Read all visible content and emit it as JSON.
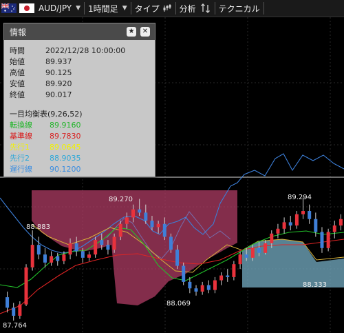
{
  "toolbar": {
    "pair": "AUD/JPY",
    "period": "1時間足",
    "type_label": "タイプ",
    "analysis_label": "分析",
    "technical_label": "テクニカル"
  },
  "info": {
    "title": "情報",
    "time_label": "時間",
    "time_value": "2022/12/28 10:00:00",
    "open_label": "始値",
    "open_value": "89.937",
    "high_label": "高値",
    "high_value": "90.125",
    "low_label": "安値",
    "low_value": "89.920",
    "close_label": "終値",
    "close_value": "90.017",
    "ichimoku_title": "一目均衡表(9,26,52)",
    "tenkan_label": "転換線",
    "tenkan_value": "89.9160",
    "kijun_label": "基準線",
    "kijun_value": "89.7830",
    "senkou1_label": "先行1",
    "senkou1_value": "89.0645",
    "senkou2_label": "先行2",
    "senkou2_value": "88.9035",
    "chikou_label": "遅行線",
    "chikou_value": "90.1200"
  },
  "colors": {
    "up": "#e8323c",
    "down": "#3f7fd8",
    "tenkan": "#22c22a",
    "kijun": "#e02424",
    "senkou1": "#d9b23a",
    "chikou": "#3c7fd8",
    "cloud_bear": "#a83a60",
    "cloud_bull": "#6ea3b8"
  },
  "chart_data": {
    "type": "candlestick",
    "price_labels": [
      "89.270",
      "88.883",
      "89.294",
      "88.069",
      "88.333",
      "87.764"
    ],
    "candles": [
      {
        "o": 88.05,
        "h": 88.12,
        "l": 87.86,
        "c": 87.92
      },
      {
        "o": 87.92,
        "h": 87.98,
        "l": 87.76,
        "c": 87.82
      },
      {
        "o": 87.82,
        "h": 88.0,
        "l": 87.78,
        "c": 87.96
      },
      {
        "o": 87.96,
        "h": 88.46,
        "l": 87.94,
        "c": 88.42
      },
      {
        "o": 88.42,
        "h": 88.88,
        "l": 88.38,
        "c": 88.7
      },
      {
        "o": 88.7,
        "h": 88.8,
        "l": 88.52,
        "c": 88.58
      },
      {
        "o": 88.58,
        "h": 88.66,
        "l": 88.42,
        "c": 88.48
      },
      {
        "o": 88.48,
        "h": 88.62,
        "l": 88.44,
        "c": 88.56
      },
      {
        "o": 88.56,
        "h": 88.6,
        "l": 88.44,
        "c": 88.5
      },
      {
        "o": 88.5,
        "h": 88.62,
        "l": 88.46,
        "c": 88.58
      },
      {
        "o": 88.58,
        "h": 88.78,
        "l": 88.52,
        "c": 88.72
      },
      {
        "o": 88.72,
        "h": 88.8,
        "l": 88.56,
        "c": 88.62
      },
      {
        "o": 88.62,
        "h": 88.66,
        "l": 88.48,
        "c": 88.54
      },
      {
        "o": 88.54,
        "h": 88.62,
        "l": 88.5,
        "c": 88.58
      },
      {
        "o": 88.58,
        "h": 88.8,
        "l": 88.54,
        "c": 88.76
      },
      {
        "o": 88.76,
        "h": 88.84,
        "l": 88.64,
        "c": 88.7
      },
      {
        "o": 88.7,
        "h": 88.76,
        "l": 88.58,
        "c": 88.64
      },
      {
        "o": 88.64,
        "h": 88.84,
        "l": 88.6,
        "c": 88.8
      },
      {
        "o": 88.8,
        "h": 89.0,
        "l": 88.76,
        "c": 88.96
      },
      {
        "o": 88.96,
        "h": 89.1,
        "l": 88.9,
        "c": 89.04
      },
      {
        "o": 89.04,
        "h": 89.2,
        "l": 88.98,
        "c": 89.14
      },
      {
        "o": 89.14,
        "h": 89.27,
        "l": 89.06,
        "c": 89.1
      },
      {
        "o": 89.1,
        "h": 89.2,
        "l": 88.96,
        "c": 89.0
      },
      {
        "o": 89.0,
        "h": 89.06,
        "l": 88.88,
        "c": 88.92
      },
      {
        "o": 88.92,
        "h": 89.0,
        "l": 88.84,
        "c": 88.96
      },
      {
        "o": 88.96,
        "h": 89.04,
        "l": 88.76,
        "c": 88.8
      },
      {
        "o": 88.8,
        "h": 88.84,
        "l": 88.6,
        "c": 88.64
      },
      {
        "o": 88.64,
        "h": 88.7,
        "l": 88.4,
        "c": 88.44
      },
      {
        "o": 88.44,
        "h": 88.48,
        "l": 88.2,
        "c": 88.24
      },
      {
        "o": 88.24,
        "h": 88.3,
        "l": 88.1,
        "c": 88.16
      },
      {
        "o": 88.16,
        "h": 88.2,
        "l": 88.07,
        "c": 88.12
      },
      {
        "o": 88.12,
        "h": 88.24,
        "l": 88.08,
        "c": 88.2
      },
      {
        "o": 88.2,
        "h": 88.26,
        "l": 88.1,
        "c": 88.14
      },
      {
        "o": 88.14,
        "h": 88.3,
        "l": 88.1,
        "c": 88.26
      },
      {
        "o": 88.26,
        "h": 88.36,
        "l": 88.2,
        "c": 88.32
      },
      {
        "o": 88.32,
        "h": 88.4,
        "l": 88.24,
        "c": 88.3
      },
      {
        "o": 88.3,
        "h": 88.5,
        "l": 88.26,
        "c": 88.46
      },
      {
        "o": 88.46,
        "h": 88.62,
        "l": 88.4,
        "c": 88.58
      },
      {
        "o": 88.58,
        "h": 88.66,
        "l": 88.5,
        "c": 88.54
      },
      {
        "o": 88.54,
        "h": 88.7,
        "l": 88.5,
        "c": 88.66
      },
      {
        "o": 88.66,
        "h": 88.74,
        "l": 88.56,
        "c": 88.6
      },
      {
        "o": 88.6,
        "h": 88.76,
        "l": 88.58,
        "c": 88.72
      },
      {
        "o": 88.72,
        "h": 88.88,
        "l": 88.66,
        "c": 88.84
      },
      {
        "o": 88.84,
        "h": 88.96,
        "l": 88.78,
        "c": 88.9
      },
      {
        "o": 88.9,
        "h": 89.04,
        "l": 88.84,
        "c": 88.98
      },
      {
        "o": 88.98,
        "h": 89.06,
        "l": 88.88,
        "c": 88.94
      },
      {
        "o": 88.94,
        "h": 89.12,
        "l": 88.9,
        "c": 89.08
      },
      {
        "o": 89.08,
        "h": 89.29,
        "l": 89.02,
        "c": 89.12
      },
      {
        "o": 89.12,
        "h": 89.2,
        "l": 88.96,
        "c": 89.02
      },
      {
        "o": 89.02,
        "h": 89.1,
        "l": 88.8,
        "c": 88.86
      },
      {
        "o": 88.86,
        "h": 88.92,
        "l": 88.6,
        "c": 88.66
      },
      {
        "o": 88.66,
        "h": 88.9,
        "l": 88.62,
        "c": 88.86
      },
      {
        "o": 88.86,
        "h": 89.0,
        "l": 88.78,
        "c": 88.94
      },
      {
        "o": 88.94,
        "h": 89.08,
        "l": 88.88,
        "c": 89.02
      }
    ]
  }
}
